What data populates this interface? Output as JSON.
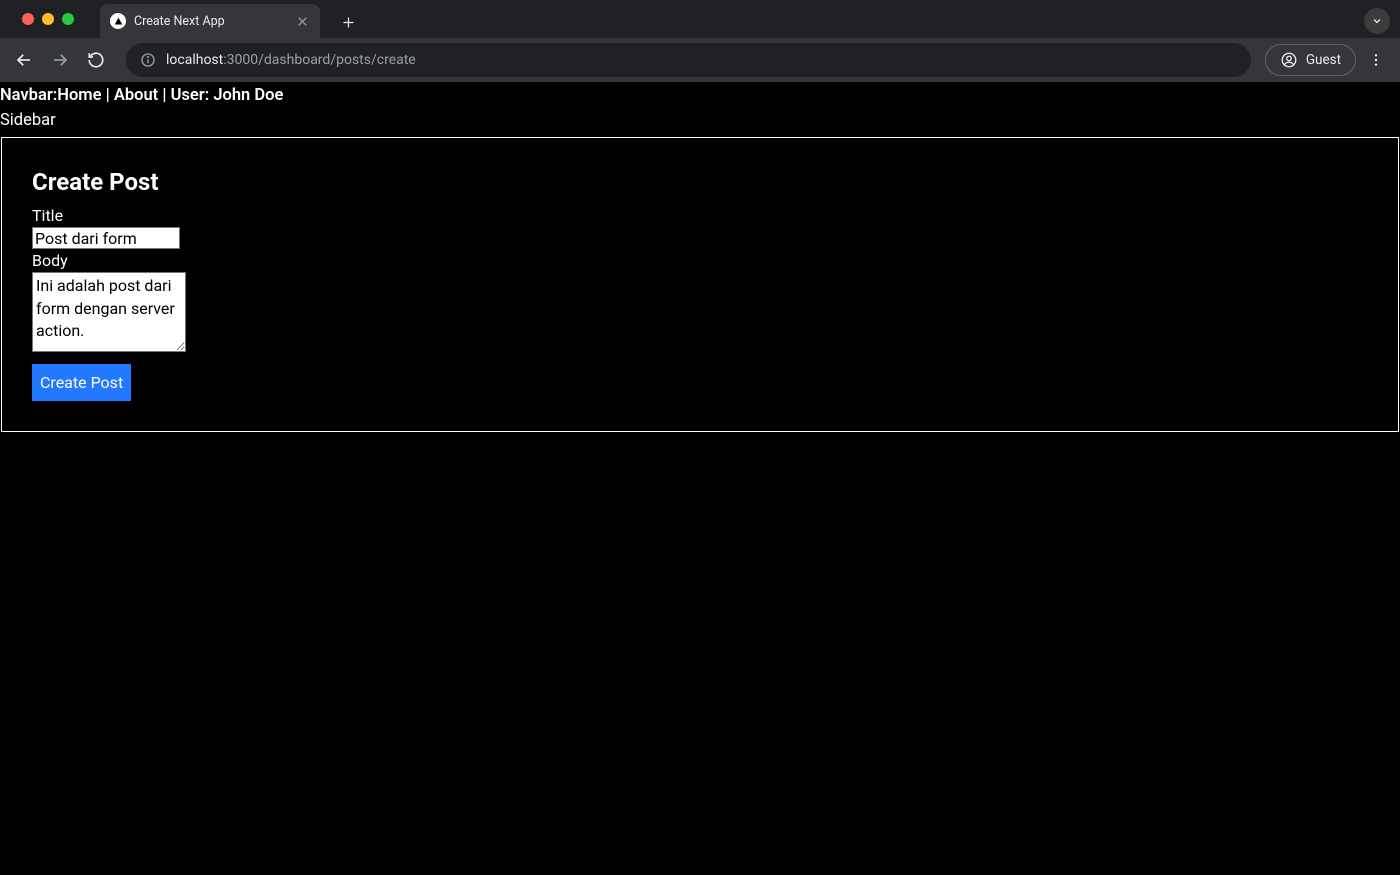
{
  "browser": {
    "tab_title": "Create Next App",
    "url_host": "localhost",
    "url_port": ":3000",
    "url_path": "/dashboard/posts/create",
    "guest_label": "Guest"
  },
  "navbar": {
    "prefix": "Navbar:",
    "home": "Home",
    "about": "About",
    "user_prefix": "User: ",
    "user_name": "John Doe",
    "sep": " | "
  },
  "sidebar": {
    "label": "Sidebar"
  },
  "page": {
    "heading": "Create Post",
    "title_label": "Title",
    "title_value": "Post dari form",
    "body_label": "Body",
    "body_value": "Ini adalah post dari form dengan server action.",
    "submit_label": "Create Post"
  }
}
